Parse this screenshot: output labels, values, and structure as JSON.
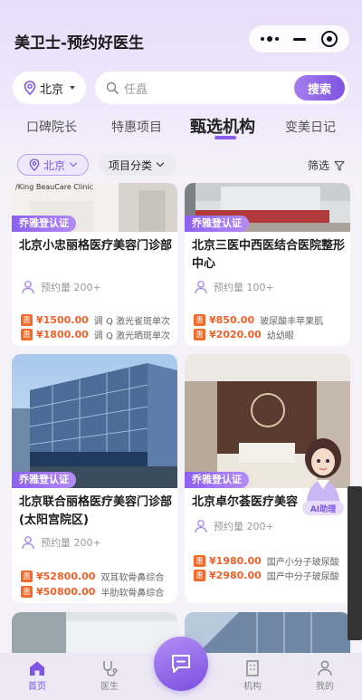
{
  "app": {
    "title": "美卫士-预约好医生"
  },
  "location": {
    "city": "北京"
  },
  "search": {
    "placeholder": "任嚞",
    "button_label": "搜索"
  },
  "tabs": [
    {
      "label": "口碑院长"
    },
    {
      "label": "特惠项目"
    },
    {
      "label": "甄选机构",
      "active": true
    },
    {
      "label": "变美日记"
    }
  ],
  "filters": {
    "city": "北京",
    "category": "项目分类",
    "screen": "筛选"
  },
  "cards": [
    {
      "badge": "乔雅登认证",
      "name": "北京小忠丽格医疗美容门诊部",
      "appt": "预约量 200+",
      "prices": [
        {
          "tag": "惠",
          "value": "¥1500.00",
          "desc": "调 Q 激光雀斑单次"
        },
        {
          "tag": "惠",
          "value": "¥1800.00",
          "desc": "调 Q 激光晒斑单次"
        }
      ]
    },
    {
      "badge": "乔雅登认证",
      "name": "北京三医中西医结合医院整形中心",
      "appt": "预约量 100+",
      "prices": [
        {
          "tag": "惠",
          "value": "¥850.00",
          "desc": "玻尿酸丰苹果肌"
        },
        {
          "tag": "惠",
          "value": "¥2020.00",
          "desc": "幼幼眼"
        }
      ]
    },
    {
      "badge": "乔雅登认证",
      "name": "北京联合丽格医疗美容门诊部(太阳宫院区)",
      "appt": "预约量 200+",
      "prices": [
        {
          "tag": "惠",
          "value": "¥52800.00",
          "desc": "双耳软骨鼻综合"
        },
        {
          "tag": "惠",
          "value": "¥50800.00",
          "desc": "半肋软骨鼻综合"
        }
      ]
    },
    {
      "badge": "乔雅登认证",
      "name": "北京卓尔荟医疗美容",
      "appt": "预约量 200+",
      "prices": [
        {
          "tag": "惠",
          "value": "¥1980.00",
          "desc": "国产小分子玻尿酸"
        },
        {
          "tag": "惠",
          "value": "¥2980.00",
          "desc": "国产中分子玻尿酸"
        }
      ]
    }
  ],
  "image_texts": {
    "card1_sign": "/King BeauCare Clinic"
  },
  "ai_assistant": {
    "label": "AI助理"
  },
  "tabbar": [
    {
      "label": "首页",
      "active": true,
      "icon": "home-icon"
    },
    {
      "label": "医生",
      "icon": "stethoscope-icon"
    },
    {
      "label": "",
      "icon": "chat-icon"
    },
    {
      "label": "机构",
      "icon": "building-icon"
    },
    {
      "label": "我的",
      "icon": "user-icon"
    }
  ],
  "colors": {
    "accent": "#8a5cf0",
    "price": "#f0602a",
    "header_bg": "#e7dcfb"
  }
}
